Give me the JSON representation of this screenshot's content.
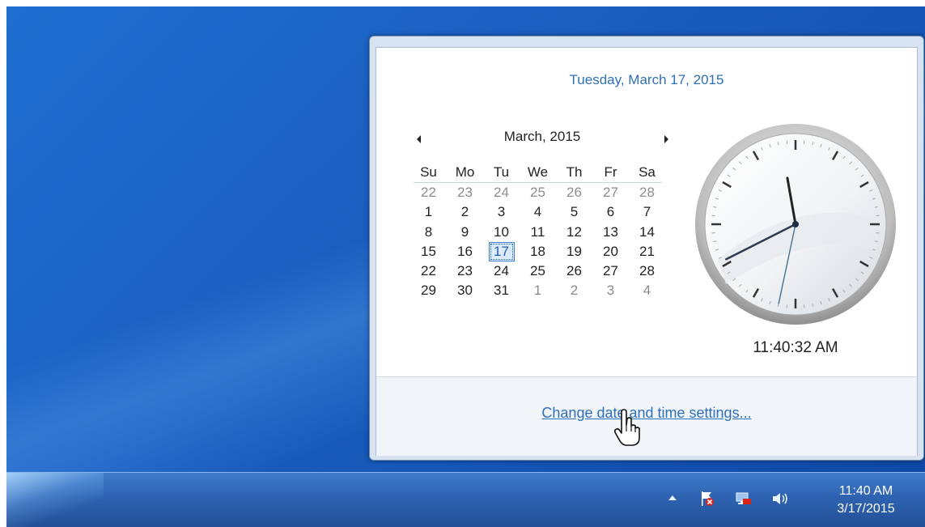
{
  "flyout": {
    "long_date": "Tuesday, March 17, 2015",
    "calendar": {
      "month_title": "March, 2015",
      "prev_icon": "triangle-left-icon",
      "next_icon": "triangle-right-icon",
      "weekdays": [
        "Su",
        "Mo",
        "Tu",
        "We",
        "Th",
        "Fr",
        "Sa"
      ],
      "weeks": [
        [
          "22",
          "23",
          "24",
          "25",
          "26",
          "27",
          "28"
        ],
        [
          "1",
          "2",
          "3",
          "4",
          "5",
          "6",
          "7"
        ],
        [
          "8",
          "9",
          "10",
          "11",
          "12",
          "13",
          "14"
        ],
        [
          "15",
          "16",
          "17",
          "18",
          "19",
          "20",
          "21"
        ],
        [
          "22",
          "23",
          "24",
          "25",
          "26",
          "27",
          "28"
        ],
        [
          "29",
          "30",
          "31",
          "1",
          "2",
          "3",
          "4"
        ]
      ],
      "selected_day": "17"
    },
    "clock": {
      "hour": 11,
      "minute": 40,
      "second": 32
    },
    "digital_time": "11:40:32 AM",
    "settings_link": "Change date and time settings..."
  },
  "taskbar": {
    "tray_icons": [
      "show-hidden-icons-arrow-icon",
      "action-center-flag-icon",
      "network-icon",
      "volume-icon"
    ],
    "time": "11:40 AM",
    "date": "3/17/2015"
  },
  "colors": {
    "link_blue": "#2f6fb8",
    "desktop_blue": "#1b61c3"
  }
}
